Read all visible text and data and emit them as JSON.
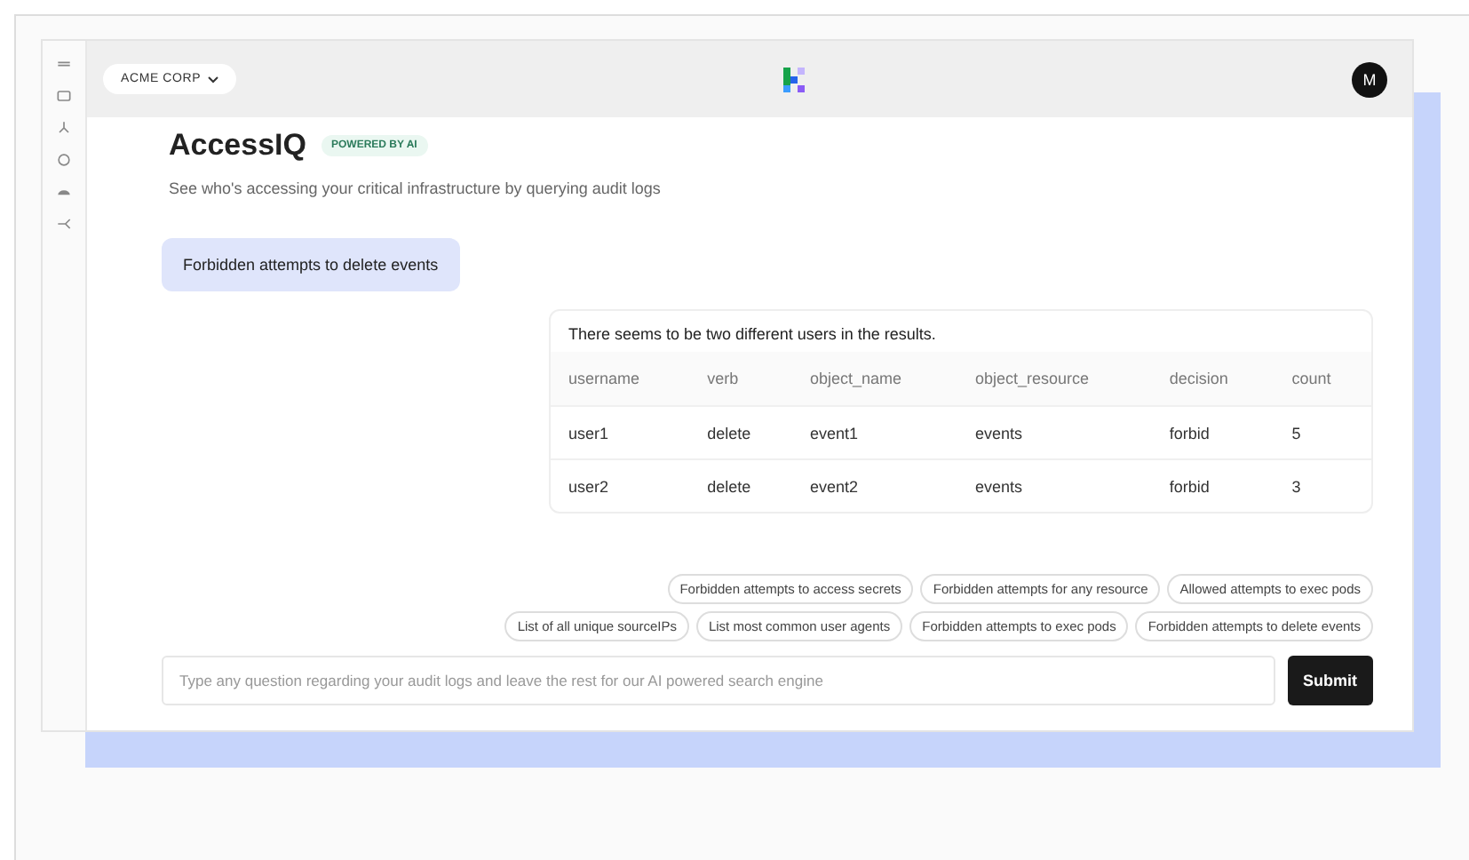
{
  "org_switcher": {
    "label": "ACME CORP"
  },
  "avatar": {
    "initial": "M"
  },
  "page": {
    "title": "AccessIQ",
    "badge": "POWERED BY AI",
    "subtitle": "See who's accessing your critical infrastructure by querying audit logs"
  },
  "query": "Forbidden attempts to delete events",
  "result": {
    "summary": "There seems to be two different users in the results.",
    "columns": [
      "username",
      "verb",
      "object_name",
      "object_resource",
      "decision",
      "count"
    ],
    "rows": [
      [
        "user1",
        "delete",
        "event1",
        "events",
        "forbid",
        "5"
      ],
      [
        "user2",
        "delete",
        "event2",
        "events",
        "forbid",
        "3"
      ]
    ]
  },
  "suggestions": [
    [
      "Forbidden attempts to access secrets",
      "Forbidden attempts for any resource",
      "Allowed attempts to exec pods"
    ],
    [
      "List of all unique sourceIPs",
      "List most common user agents",
      "Forbidden attempts to exec pods",
      "Forbidden attempts to delete events"
    ]
  ],
  "search": {
    "placeholder": "Type any question regarding your audit logs and leave the rest for our AI powered search engine"
  },
  "submit": "Submit"
}
